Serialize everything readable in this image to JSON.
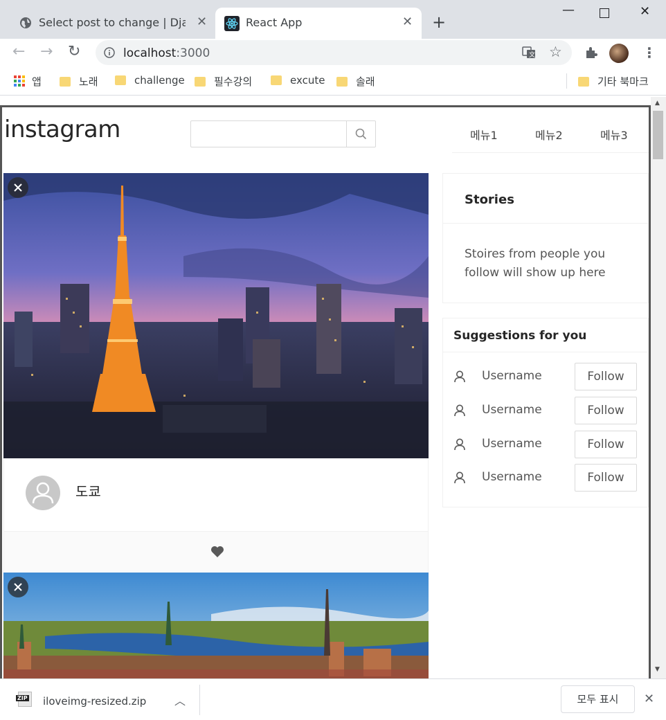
{
  "browser": {
    "tabs": [
      {
        "title": "Select post to change | Django",
        "icon": "globe-icon"
      },
      {
        "title": "React App",
        "icon": "react-icon"
      }
    ],
    "url": "localhost",
    "url_port": ":3000",
    "bookmarks": [
      "앱",
      "노래",
      "challenge",
      "필수강의",
      "excute",
      "솔래"
    ],
    "other_bookmarks": "기타 북마크"
  },
  "app": {
    "logo": "instagram",
    "search": {
      "placeholder": "",
      "value": ""
    },
    "menu": [
      "메뉴1",
      "메뉴2",
      "메뉴3"
    ]
  },
  "posts": [
    {
      "caption": "도쿄",
      "image": "tokyo-tower-night-skyline"
    },
    {
      "caption": "",
      "image": "stockholm-city-panorama"
    }
  ],
  "stories": {
    "title": "Stories",
    "body_line1": "Stoires from people you",
    "body_line2": "follow will show up here"
  },
  "suggestions": {
    "title": "Suggestions for you",
    "items": [
      {
        "name": "Username",
        "action": "Follow"
      },
      {
        "name": "Username",
        "action": "Follow"
      },
      {
        "name": "Username",
        "action": "Follow"
      },
      {
        "name": "Username",
        "action": "Follow"
      }
    ]
  },
  "download": {
    "filename": "iloveimg-resized.zip",
    "file_badge": "ZIP",
    "show_all": "모두 표시"
  },
  "colors": {
    "accent_heart": "#595959",
    "text": "#262626",
    "border": "#f0f0f0"
  }
}
